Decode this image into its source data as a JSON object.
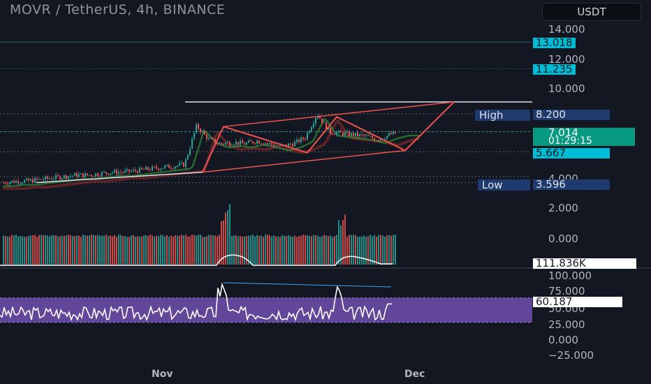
{
  "header": {
    "title": "MOVR / TetherUS, 4h, BINANCE",
    "currency_button": "USDT"
  },
  "colors": {
    "background": "#131722",
    "candle_up": "#26a69a",
    "candle_down": "#ef5350",
    "pattern_lines": "#ef5350",
    "rsi_band": "#7e57c2",
    "rsi_line": "#ffffff",
    "tag_cyan": "#00bcd4",
    "tag_current": "#089981",
    "tag_navy": "#1e3a6e"
  },
  "price_axis": {
    "ticks": [
      "14.000",
      "12.000",
      "10.000",
      "4.000"
    ],
    "tags": {
      "level_1": "13.018",
      "level_2": "11.235",
      "high_label": "High",
      "high_value": "8.200",
      "current_price": "7.014",
      "countdown": "01:29:15",
      "level_3": "5.667",
      "low_label": "Low",
      "low_value": "3.596"
    }
  },
  "volume_axis": {
    "ticks": [
      "2.000",
      "0.000"
    ],
    "value_tag": "111.836K"
  },
  "rsi_axis": {
    "ticks": [
      "100.000",
      "75.000",
      "50.000",
      "25.000",
      "0.000",
      "−25.000"
    ],
    "value_tag": "60.187"
  },
  "x_axis": {
    "labels": [
      "Nov",
      "Dec"
    ]
  },
  "chart_data": {
    "type": "candlestick",
    "symbol": "MOVR / TetherUS",
    "interval": "4h",
    "exchange": "BINANCE",
    "x_labels": [
      "Nov",
      "Dec"
    ],
    "price_ticks": [
      14,
      12,
      10,
      4
    ],
    "current_price": 7.014,
    "high": 8.2,
    "low": 3.596,
    "horizontal_levels": [
      13.018,
      11.235,
      9.0,
      5.667
    ],
    "price_path": [
      3.6,
      3.7,
      3.7,
      3.8,
      3.9,
      4.0,
      4.1,
      4.1,
      4.2,
      4.3,
      4.3,
      4.4,
      4.5,
      4.6,
      4.7,
      4.8,
      7.4,
      6.5,
      6.2,
      6.3,
      6.2,
      6.4,
      6.2,
      6.0,
      6.2,
      6.6,
      8.2,
      7.0,
      6.9,
      6.8,
      6.7,
      6.5,
      6.8,
      7.0
    ],
    "volume_axis_ticks": [
      2.0,
      0.0
    ],
    "volume_last": "111.836K",
    "rsi_axis_ticks": [
      100,
      75,
      50,
      25,
      0,
      -25
    ],
    "rsi_band": [
      30,
      70
    ],
    "rsi_last": 60.187
  }
}
